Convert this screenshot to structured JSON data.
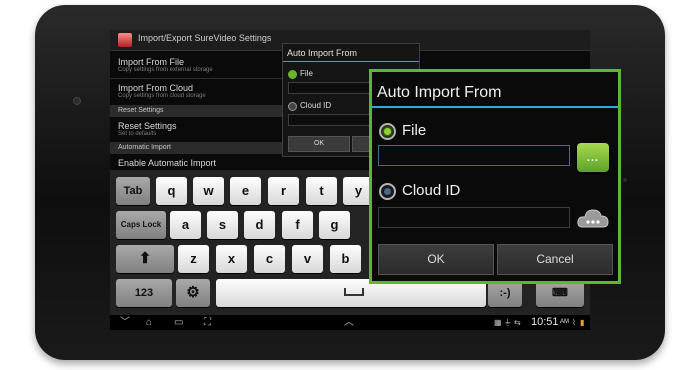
{
  "app": {
    "title": "Import/Export SureVideo Settings"
  },
  "settings": {
    "items": [
      {
        "title": "Import From File",
        "subtitle": "Copy settings from external storage"
      },
      {
        "title": "Import From Cloud",
        "subtitle": "Copy settings from cloud storage"
      }
    ],
    "section_reset": "Reset Settings",
    "reset_item": {
      "title": "Reset Settings",
      "subtitle": "Set to defaults"
    },
    "section_auto": "Automatic Import",
    "auto_item": {
      "title": "Enable Automatic Import"
    }
  },
  "keyboard": {
    "row1": [
      "Tab",
      "q",
      "w",
      "e",
      "r",
      "t",
      "y"
    ],
    "row2": [
      "Caps Lock",
      "a",
      "s",
      "d",
      "f",
      "g"
    ],
    "row3": [
      "z",
      "x",
      "c",
      "v",
      "b"
    ],
    "row4": [
      "123",
      ":-)"
    ]
  },
  "statusbar": {
    "time": "10:51",
    "ampm": "AM"
  },
  "dialog_small": {
    "title": "Auto Import From",
    "file_label": "File",
    "cloud_label": "Cloud ID",
    "ok_label": "OK"
  },
  "dialog": {
    "title": "Auto Import From",
    "file_label": "File",
    "file_value": "",
    "cloud_label": "Cloud ID",
    "cloud_value": "",
    "browse_dots": "...",
    "ok_label": "OK",
    "cancel_label": "Cancel",
    "selected_option": "File"
  },
  "colors": {
    "highlight_border": "#5fb630",
    "dialog_rule": "#35a4d6",
    "radio_selected": "#8cd42b"
  },
  "icons": [
    "gear-icon",
    "up-arrow-icon",
    "back-icon",
    "home-icon",
    "recent-apps-icon",
    "screenshot-icon",
    "chevron-up-icon",
    "usb-icon",
    "wifi-icon",
    "battery-icon",
    "cloud-icon"
  ]
}
